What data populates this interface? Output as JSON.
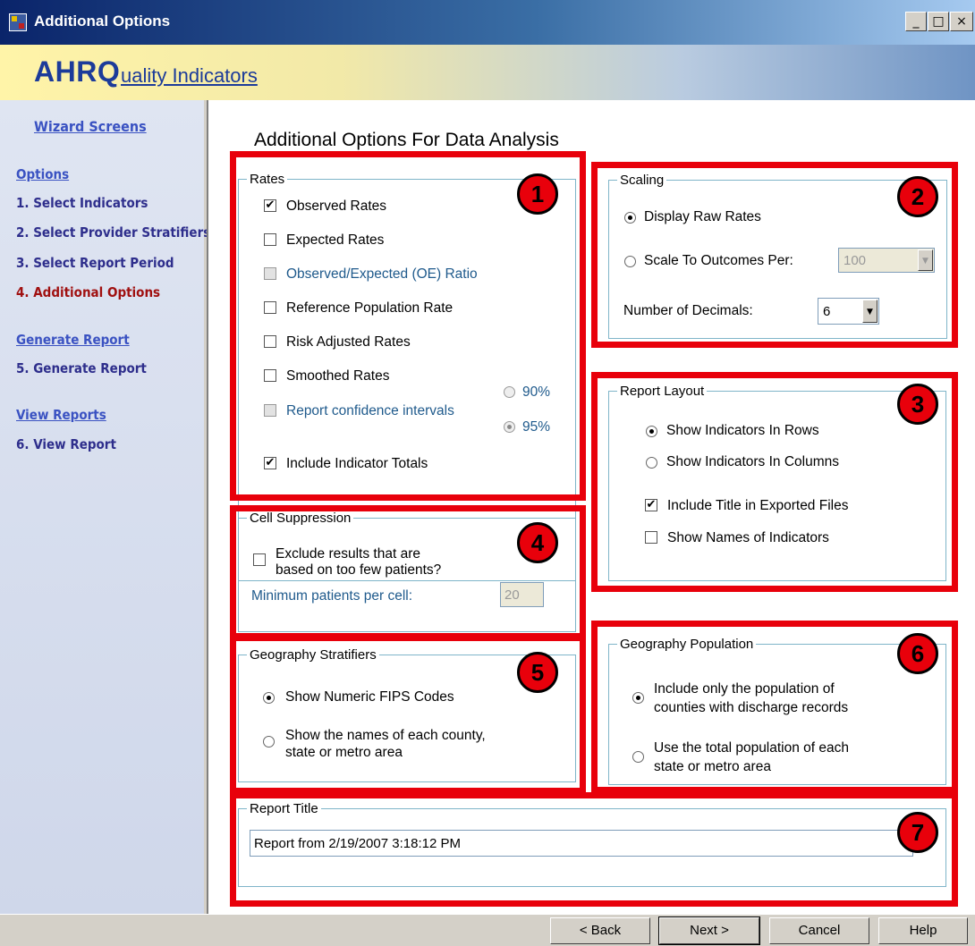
{
  "window": {
    "title": "Additional Options",
    "controls": [
      "_",
      "□",
      "×"
    ]
  },
  "banner": {
    "logo_main": "AHRQ",
    "logo_sub": "uality Indicators"
  },
  "sidebar": {
    "wizard_screens": "Wizard Screens",
    "options_header": "Options",
    "item1": "1. Select Indicators",
    "item2": "2. Select Provider Stratifiers",
    "item3": "3. Select Report Period",
    "item4": "4. Additional Options",
    "generate_header": "Generate Report",
    "item5": "5. Generate Report",
    "view_header": "View Reports",
    "item6": "6. View Report"
  },
  "main": {
    "heading": "Additional Options For Data Analysis",
    "rates": {
      "label": "Rates",
      "observed": "Observed Rates",
      "expected": "Expected Rates",
      "oe_ratio": "Observed/Expected (OE) Ratio",
      "reference": "Reference Population Rate",
      "risk_adjusted": "Risk Adjusted Rates",
      "smoothed": "Smoothed Rates",
      "confidence": "Report confidence intervals",
      "ci90": "90%",
      "ci95": "95%",
      "totals": "Include Indicator Totals"
    },
    "scaling": {
      "label": "Scaling",
      "raw": "Display Raw Rates",
      "scale_to": "Scale To Outcomes Per:",
      "scale_value": "100",
      "decimals_label": "Number of Decimals:",
      "decimals_value": "6"
    },
    "layout": {
      "label": "Report Layout",
      "rows": "Show Indicators In Rows",
      "columns": "Show Indicators In Columns",
      "title_export": "Include Title in Exported Files",
      "names": "Show Names of Indicators"
    },
    "suppression": {
      "label": "Cell Suppression",
      "exclude_line1": "Exclude results that are",
      "exclude_line2": "based on too few patients?",
      "min_label": "Minimum patients per cell:",
      "min_value": "20"
    },
    "geo_strat": {
      "label": "Geography Stratifiers",
      "fips": "Show Numeric FIPS Codes",
      "names_line1": "Show the names of each county,",
      "names_line2": "state or metro area"
    },
    "geo_pop": {
      "label": "Geography Population",
      "only_line1": "Include only the population of",
      "only_line2": "counties with discharge records",
      "total_line1": "Use the total population of each",
      "total_line2": "state or metro area"
    },
    "report_title": {
      "label": "Report Title",
      "value": "Report from 2/19/2007 3:18:12 PM"
    },
    "badges": [
      "1",
      "2",
      "3",
      "4",
      "5",
      "6",
      "7"
    ]
  },
  "buttons": {
    "back": "< Back",
    "next": "Next >",
    "cancel": "Cancel",
    "help": "Help"
  },
  "colors": {
    "highlight": "#e8000b",
    "active_step": "#a01010",
    "sidebar_text": "#2e2e8c"
  }
}
